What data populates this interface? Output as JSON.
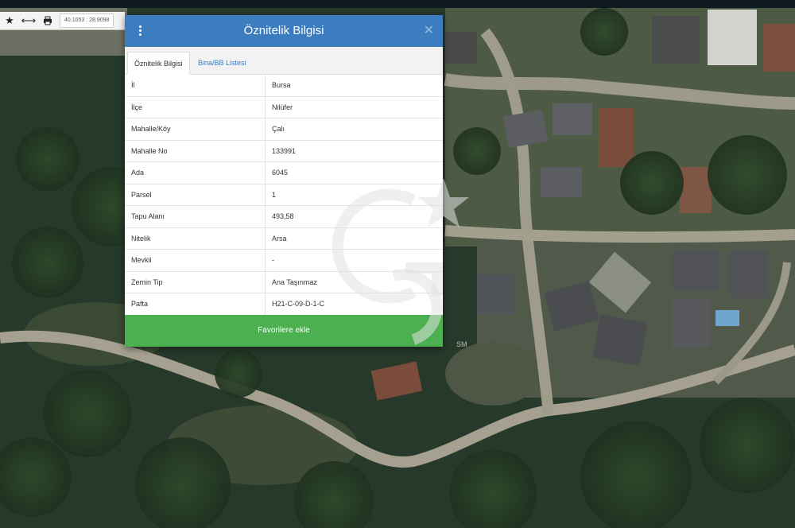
{
  "toolbar": {
    "coords": "40.1053 : 28.9098",
    "icons": [
      "star-icon",
      "measure-icon",
      "print-icon"
    ]
  },
  "dialog": {
    "title": "Öznitelik Bilgisi",
    "tabs": [
      {
        "label": "Öznitelik Bilgisi",
        "active": true
      },
      {
        "label": "Bina/BB Listesi",
        "active": false
      }
    ],
    "rows": [
      {
        "key": "İl",
        "value": "Bursa"
      },
      {
        "key": "İlçe",
        "value": "Nilüfer"
      },
      {
        "key": "Mahalle/Köy",
        "value": "Çalı"
      },
      {
        "key": "Mahalle No",
        "value": "133991"
      },
      {
        "key": "Ada",
        "value": "6045"
      },
      {
        "key": "Parsel",
        "value": "1"
      },
      {
        "key": "Tapu Alanı",
        "value": "493,58"
      },
      {
        "key": "Nitelik",
        "value": "Arsa"
      },
      {
        "key": "Mevkii",
        "value": "-"
      },
      {
        "key": "Zemin Tip",
        "value": "Ana Taşınmaz"
      },
      {
        "key": "Pafta",
        "value": "H21-C-09-D-1-C"
      }
    ],
    "favorite_button": "Favorilere ekle"
  },
  "watermark": {
    "text": "SM"
  },
  "colors": {
    "header": "#3c7dbf",
    "button": "#4caf50"
  }
}
